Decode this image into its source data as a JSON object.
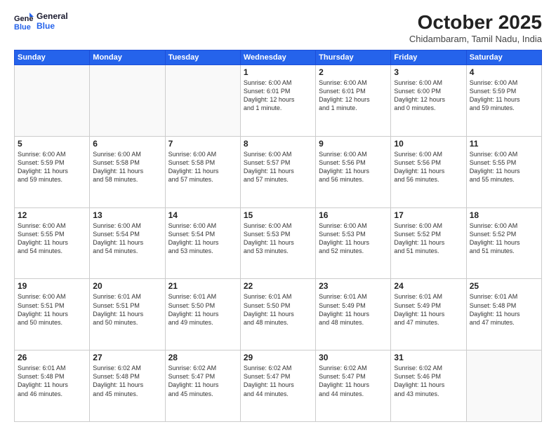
{
  "header": {
    "logo_line1": "General",
    "logo_line2": "Blue",
    "month": "October 2025",
    "location": "Chidambaram, Tamil Nadu, India"
  },
  "weekdays": [
    "Sunday",
    "Monday",
    "Tuesday",
    "Wednesday",
    "Thursday",
    "Friday",
    "Saturday"
  ],
  "weeks": [
    [
      {
        "day": "",
        "text": ""
      },
      {
        "day": "",
        "text": ""
      },
      {
        "day": "",
        "text": ""
      },
      {
        "day": "1",
        "text": "Sunrise: 6:00 AM\nSunset: 6:01 PM\nDaylight: 12 hours\nand 1 minute."
      },
      {
        "day": "2",
        "text": "Sunrise: 6:00 AM\nSunset: 6:01 PM\nDaylight: 12 hours\nand 1 minute."
      },
      {
        "day": "3",
        "text": "Sunrise: 6:00 AM\nSunset: 6:00 PM\nDaylight: 12 hours\nand 0 minutes."
      },
      {
        "day": "4",
        "text": "Sunrise: 6:00 AM\nSunset: 5:59 PM\nDaylight: 11 hours\nand 59 minutes."
      }
    ],
    [
      {
        "day": "5",
        "text": "Sunrise: 6:00 AM\nSunset: 5:59 PM\nDaylight: 11 hours\nand 59 minutes."
      },
      {
        "day": "6",
        "text": "Sunrise: 6:00 AM\nSunset: 5:58 PM\nDaylight: 11 hours\nand 58 minutes."
      },
      {
        "day": "7",
        "text": "Sunrise: 6:00 AM\nSunset: 5:58 PM\nDaylight: 11 hours\nand 57 minutes."
      },
      {
        "day": "8",
        "text": "Sunrise: 6:00 AM\nSunset: 5:57 PM\nDaylight: 11 hours\nand 57 minutes."
      },
      {
        "day": "9",
        "text": "Sunrise: 6:00 AM\nSunset: 5:56 PM\nDaylight: 11 hours\nand 56 minutes."
      },
      {
        "day": "10",
        "text": "Sunrise: 6:00 AM\nSunset: 5:56 PM\nDaylight: 11 hours\nand 56 minutes."
      },
      {
        "day": "11",
        "text": "Sunrise: 6:00 AM\nSunset: 5:55 PM\nDaylight: 11 hours\nand 55 minutes."
      }
    ],
    [
      {
        "day": "12",
        "text": "Sunrise: 6:00 AM\nSunset: 5:55 PM\nDaylight: 11 hours\nand 54 minutes."
      },
      {
        "day": "13",
        "text": "Sunrise: 6:00 AM\nSunset: 5:54 PM\nDaylight: 11 hours\nand 54 minutes."
      },
      {
        "day": "14",
        "text": "Sunrise: 6:00 AM\nSunset: 5:54 PM\nDaylight: 11 hours\nand 53 minutes."
      },
      {
        "day": "15",
        "text": "Sunrise: 6:00 AM\nSunset: 5:53 PM\nDaylight: 11 hours\nand 53 minutes."
      },
      {
        "day": "16",
        "text": "Sunrise: 6:00 AM\nSunset: 5:53 PM\nDaylight: 11 hours\nand 52 minutes."
      },
      {
        "day": "17",
        "text": "Sunrise: 6:00 AM\nSunset: 5:52 PM\nDaylight: 11 hours\nand 51 minutes."
      },
      {
        "day": "18",
        "text": "Sunrise: 6:00 AM\nSunset: 5:52 PM\nDaylight: 11 hours\nand 51 minutes."
      }
    ],
    [
      {
        "day": "19",
        "text": "Sunrise: 6:00 AM\nSunset: 5:51 PM\nDaylight: 11 hours\nand 50 minutes."
      },
      {
        "day": "20",
        "text": "Sunrise: 6:01 AM\nSunset: 5:51 PM\nDaylight: 11 hours\nand 50 minutes."
      },
      {
        "day": "21",
        "text": "Sunrise: 6:01 AM\nSunset: 5:50 PM\nDaylight: 11 hours\nand 49 minutes."
      },
      {
        "day": "22",
        "text": "Sunrise: 6:01 AM\nSunset: 5:50 PM\nDaylight: 11 hours\nand 48 minutes."
      },
      {
        "day": "23",
        "text": "Sunrise: 6:01 AM\nSunset: 5:49 PM\nDaylight: 11 hours\nand 48 minutes."
      },
      {
        "day": "24",
        "text": "Sunrise: 6:01 AM\nSunset: 5:49 PM\nDaylight: 11 hours\nand 47 minutes."
      },
      {
        "day": "25",
        "text": "Sunrise: 6:01 AM\nSunset: 5:48 PM\nDaylight: 11 hours\nand 47 minutes."
      }
    ],
    [
      {
        "day": "26",
        "text": "Sunrise: 6:01 AM\nSunset: 5:48 PM\nDaylight: 11 hours\nand 46 minutes."
      },
      {
        "day": "27",
        "text": "Sunrise: 6:02 AM\nSunset: 5:48 PM\nDaylight: 11 hours\nand 45 minutes."
      },
      {
        "day": "28",
        "text": "Sunrise: 6:02 AM\nSunset: 5:47 PM\nDaylight: 11 hours\nand 45 minutes."
      },
      {
        "day": "29",
        "text": "Sunrise: 6:02 AM\nSunset: 5:47 PM\nDaylight: 11 hours\nand 44 minutes."
      },
      {
        "day": "30",
        "text": "Sunrise: 6:02 AM\nSunset: 5:47 PM\nDaylight: 11 hours\nand 44 minutes."
      },
      {
        "day": "31",
        "text": "Sunrise: 6:02 AM\nSunset: 5:46 PM\nDaylight: 11 hours\nand 43 minutes."
      },
      {
        "day": "",
        "text": ""
      }
    ]
  ]
}
